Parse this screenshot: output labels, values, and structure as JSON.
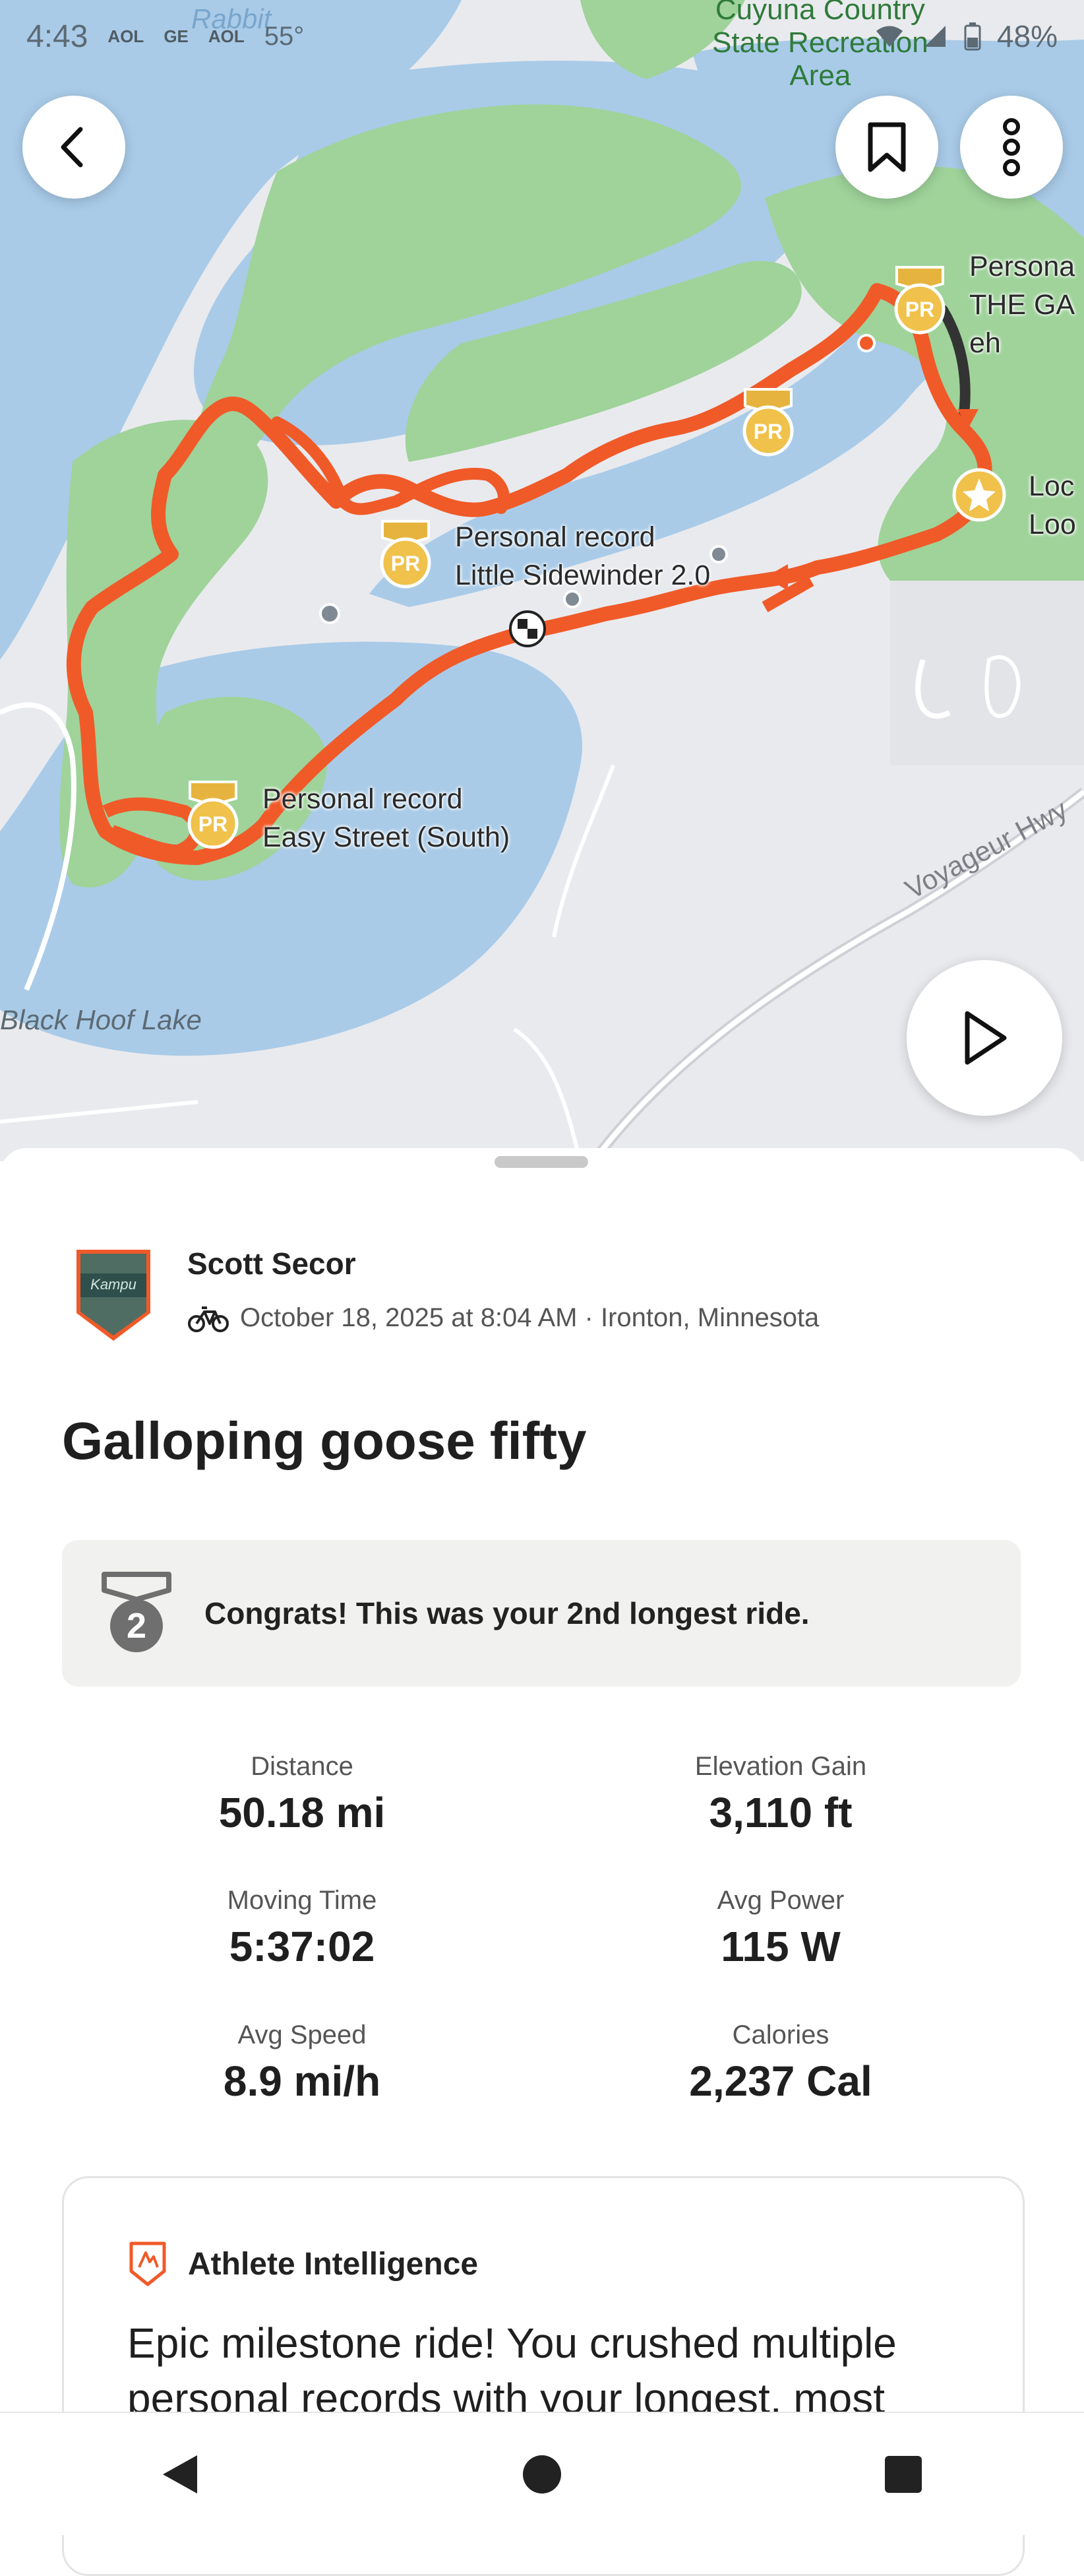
{
  "status_bar": {
    "time": "4:43",
    "icons": [
      "AOL",
      "GE",
      "AOL"
    ],
    "temperature": "55°",
    "battery": "48%"
  },
  "map": {
    "area_label": "Cuyuna Country\nState Recreation\nArea",
    "lake_label": "Black Hoof Lake",
    "road_label": "Voyageur Hwy",
    "partial_label_top": "Rabbit",
    "pr_labels": [
      {
        "title": "Personal record",
        "segment": "Little Sidewinder 2.0"
      },
      {
        "title": "Personal record",
        "segment": "Easy Street (South)"
      },
      {
        "title": "Persona",
        "segment": "THE GA",
        "extra": "eh"
      },
      {
        "title": "Loc",
        "segment": "Loo"
      }
    ],
    "route_color": "#f05a28",
    "pr_badge_text": "PR"
  },
  "activity": {
    "athlete_name": "Scott Secor",
    "meta": "October 18, 2025 at 8:04 AM · Ironton, Minnesota",
    "title": "Galloping goose fifty",
    "achievement": "Congrats! This was your 2nd longest ride.",
    "achievement_rank": "2",
    "stats": [
      {
        "label": "Distance",
        "value": "50.18 mi"
      },
      {
        "label": "Elevation Gain",
        "value": "3,110 ft"
      },
      {
        "label": "Moving Time",
        "value": "5:37:02"
      },
      {
        "label": "Avg Power",
        "value": "115 W"
      },
      {
        "label": "Avg Speed",
        "value": "8.9 mi/h"
      },
      {
        "label": "Calories",
        "value": "2,237 Cal"
      }
    ]
  },
  "athlete_intelligence": {
    "title": "Athlete Intelligence",
    "body": "Epic milestone ride! You crushed multiple personal records with your longest, most"
  },
  "icons": {
    "back": "chevron-left-icon",
    "bookmark": "bookmark-icon",
    "more": "more-vertical-icon",
    "play": "play-icon",
    "bike": "bike-icon",
    "medal": "medal-icon",
    "ai": "athlete-intelligence-icon"
  }
}
